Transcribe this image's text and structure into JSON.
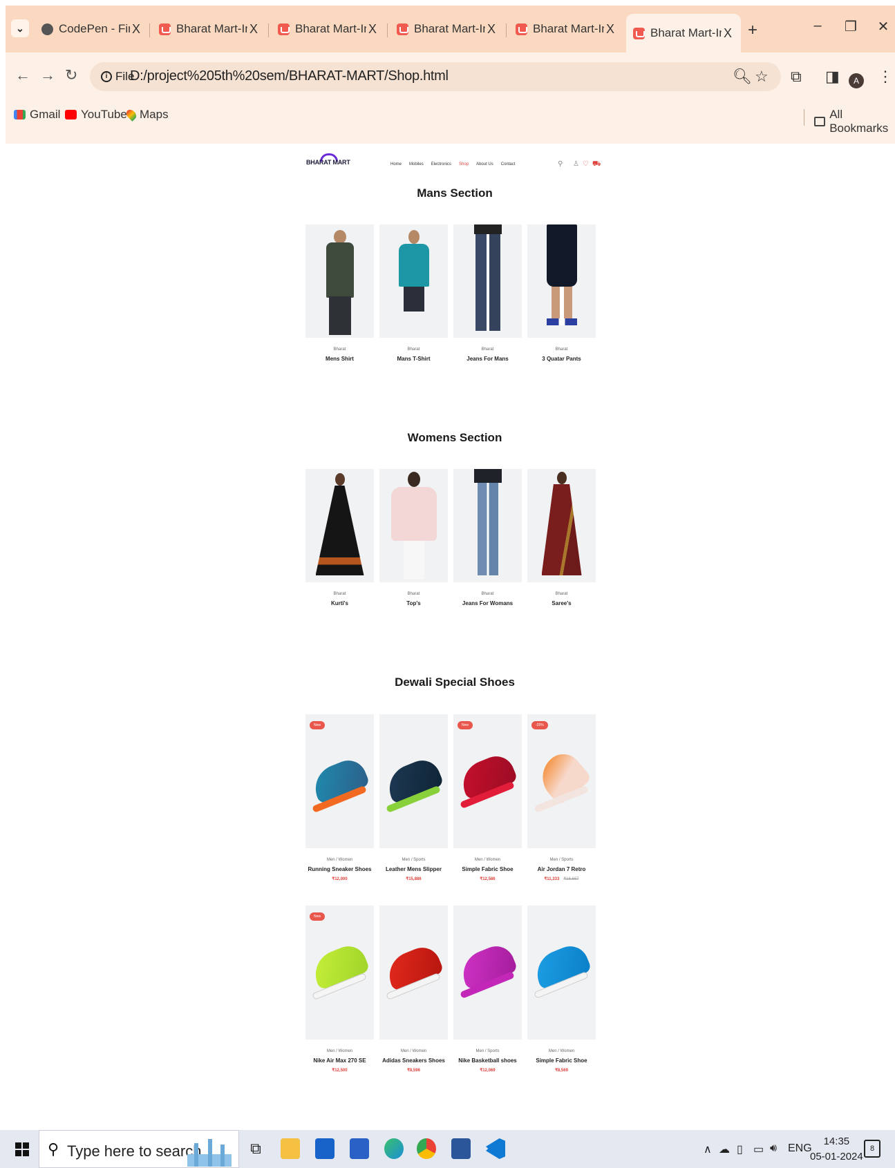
{
  "browser": {
    "tabs": [
      {
        "title": "CodePen - Finance",
        "close": "X"
      },
      {
        "title": "Bharat Mart-Indian",
        "close": "X"
      },
      {
        "title": "Bharat Mart-Indian",
        "close": "X"
      },
      {
        "title": "Bharat Mart-Indian",
        "close": "X"
      },
      {
        "title": "Bharat Mart-Indian",
        "close": "X"
      },
      {
        "title": "Bharat Mart-Indian",
        "close": "X"
      }
    ],
    "file_chip": "File",
    "url": "D:/project%205th%20sem/BHARAT-MART/Shop.html",
    "avatar_letter": "A",
    "bookmarks": [
      {
        "label": "Gmail",
        "icon": "gmail-icon"
      },
      {
        "label": "YouTube",
        "icon": "youtube-icon"
      },
      {
        "label": "Maps",
        "icon": "maps-icon"
      }
    ],
    "all_bookmarks": "All Bookmarks"
  },
  "site": {
    "logo": "BHARAT MART",
    "nav": [
      "Home",
      "Mobiles",
      "Electronics",
      "Shop",
      "About Us",
      "Contact"
    ],
    "nav_active": 3
  },
  "mens": {
    "title": "Mans Section",
    "items": [
      {
        "brand": "Bharat",
        "name": "Mens Shirt"
      },
      {
        "brand": "Bharat",
        "name": "Mans T-Shirt"
      },
      {
        "brand": "Bharat",
        "name": "Jeans For Mans"
      },
      {
        "brand": "Bharat",
        "name": "3 Quatar Pants"
      }
    ]
  },
  "womens": {
    "title": "Womens Section",
    "items": [
      {
        "brand": "Bharat",
        "name": "Kurti's"
      },
      {
        "brand": "Bharat",
        "name": "Top's"
      },
      {
        "brand": "Bharat",
        "name": "Jeans For Womans"
      },
      {
        "brand": "Bharat",
        "name": "Saree's"
      }
    ]
  },
  "shoes": {
    "title": "Dewali Special Shoes",
    "items": [
      {
        "badge": "New",
        "cat": "Men / Women",
        "name": "Running Sneaker Shoes",
        "price": "₹12,000",
        "old_price": ""
      },
      {
        "badge": "",
        "cat": "Men / Sports",
        "name": "Leather Mens Slipper",
        "price": "₹15,886",
        "old_price": ""
      },
      {
        "badge": "New",
        "cat": "Men / Women",
        "name": "Simple Fabric Shoe",
        "price": "₹12,586",
        "old_price": ""
      },
      {
        "badge": "-25%",
        "cat": "Men / Sports",
        "name": "Air Jordan 7 Retro",
        "price": "₹11,333",
        "old_price": "₹16,667"
      },
      {
        "badge": "New",
        "cat": "Men / Women",
        "name": "Nike Air Max 270 SE",
        "price": "₹12,500",
        "old_price": ""
      },
      {
        "badge": "",
        "cat": "Men / Women",
        "name": "Adidas Sneakers Shoes",
        "price": "₹8,596",
        "old_price": ""
      },
      {
        "badge": "",
        "cat": "Men / Sports",
        "name": "Nike Basketball shoes",
        "price": "₹12,069",
        "old_price": ""
      },
      {
        "badge": "",
        "cat": "Men / Women",
        "name": "Simple Fabric Shoe",
        "price": "₹8,569",
        "old_price": ""
      }
    ]
  },
  "taskbar": {
    "search_placeholder": "Type here to search",
    "lang": "ENG",
    "time": "14:35",
    "date": "05-01-2024",
    "notifications": "8"
  },
  "colors": {
    "accent_red": "#e0403a",
    "badge": "#e9574c",
    "tab_strip": "#fbd9c0",
    "chrome_bg": "#fdf0e6"
  }
}
